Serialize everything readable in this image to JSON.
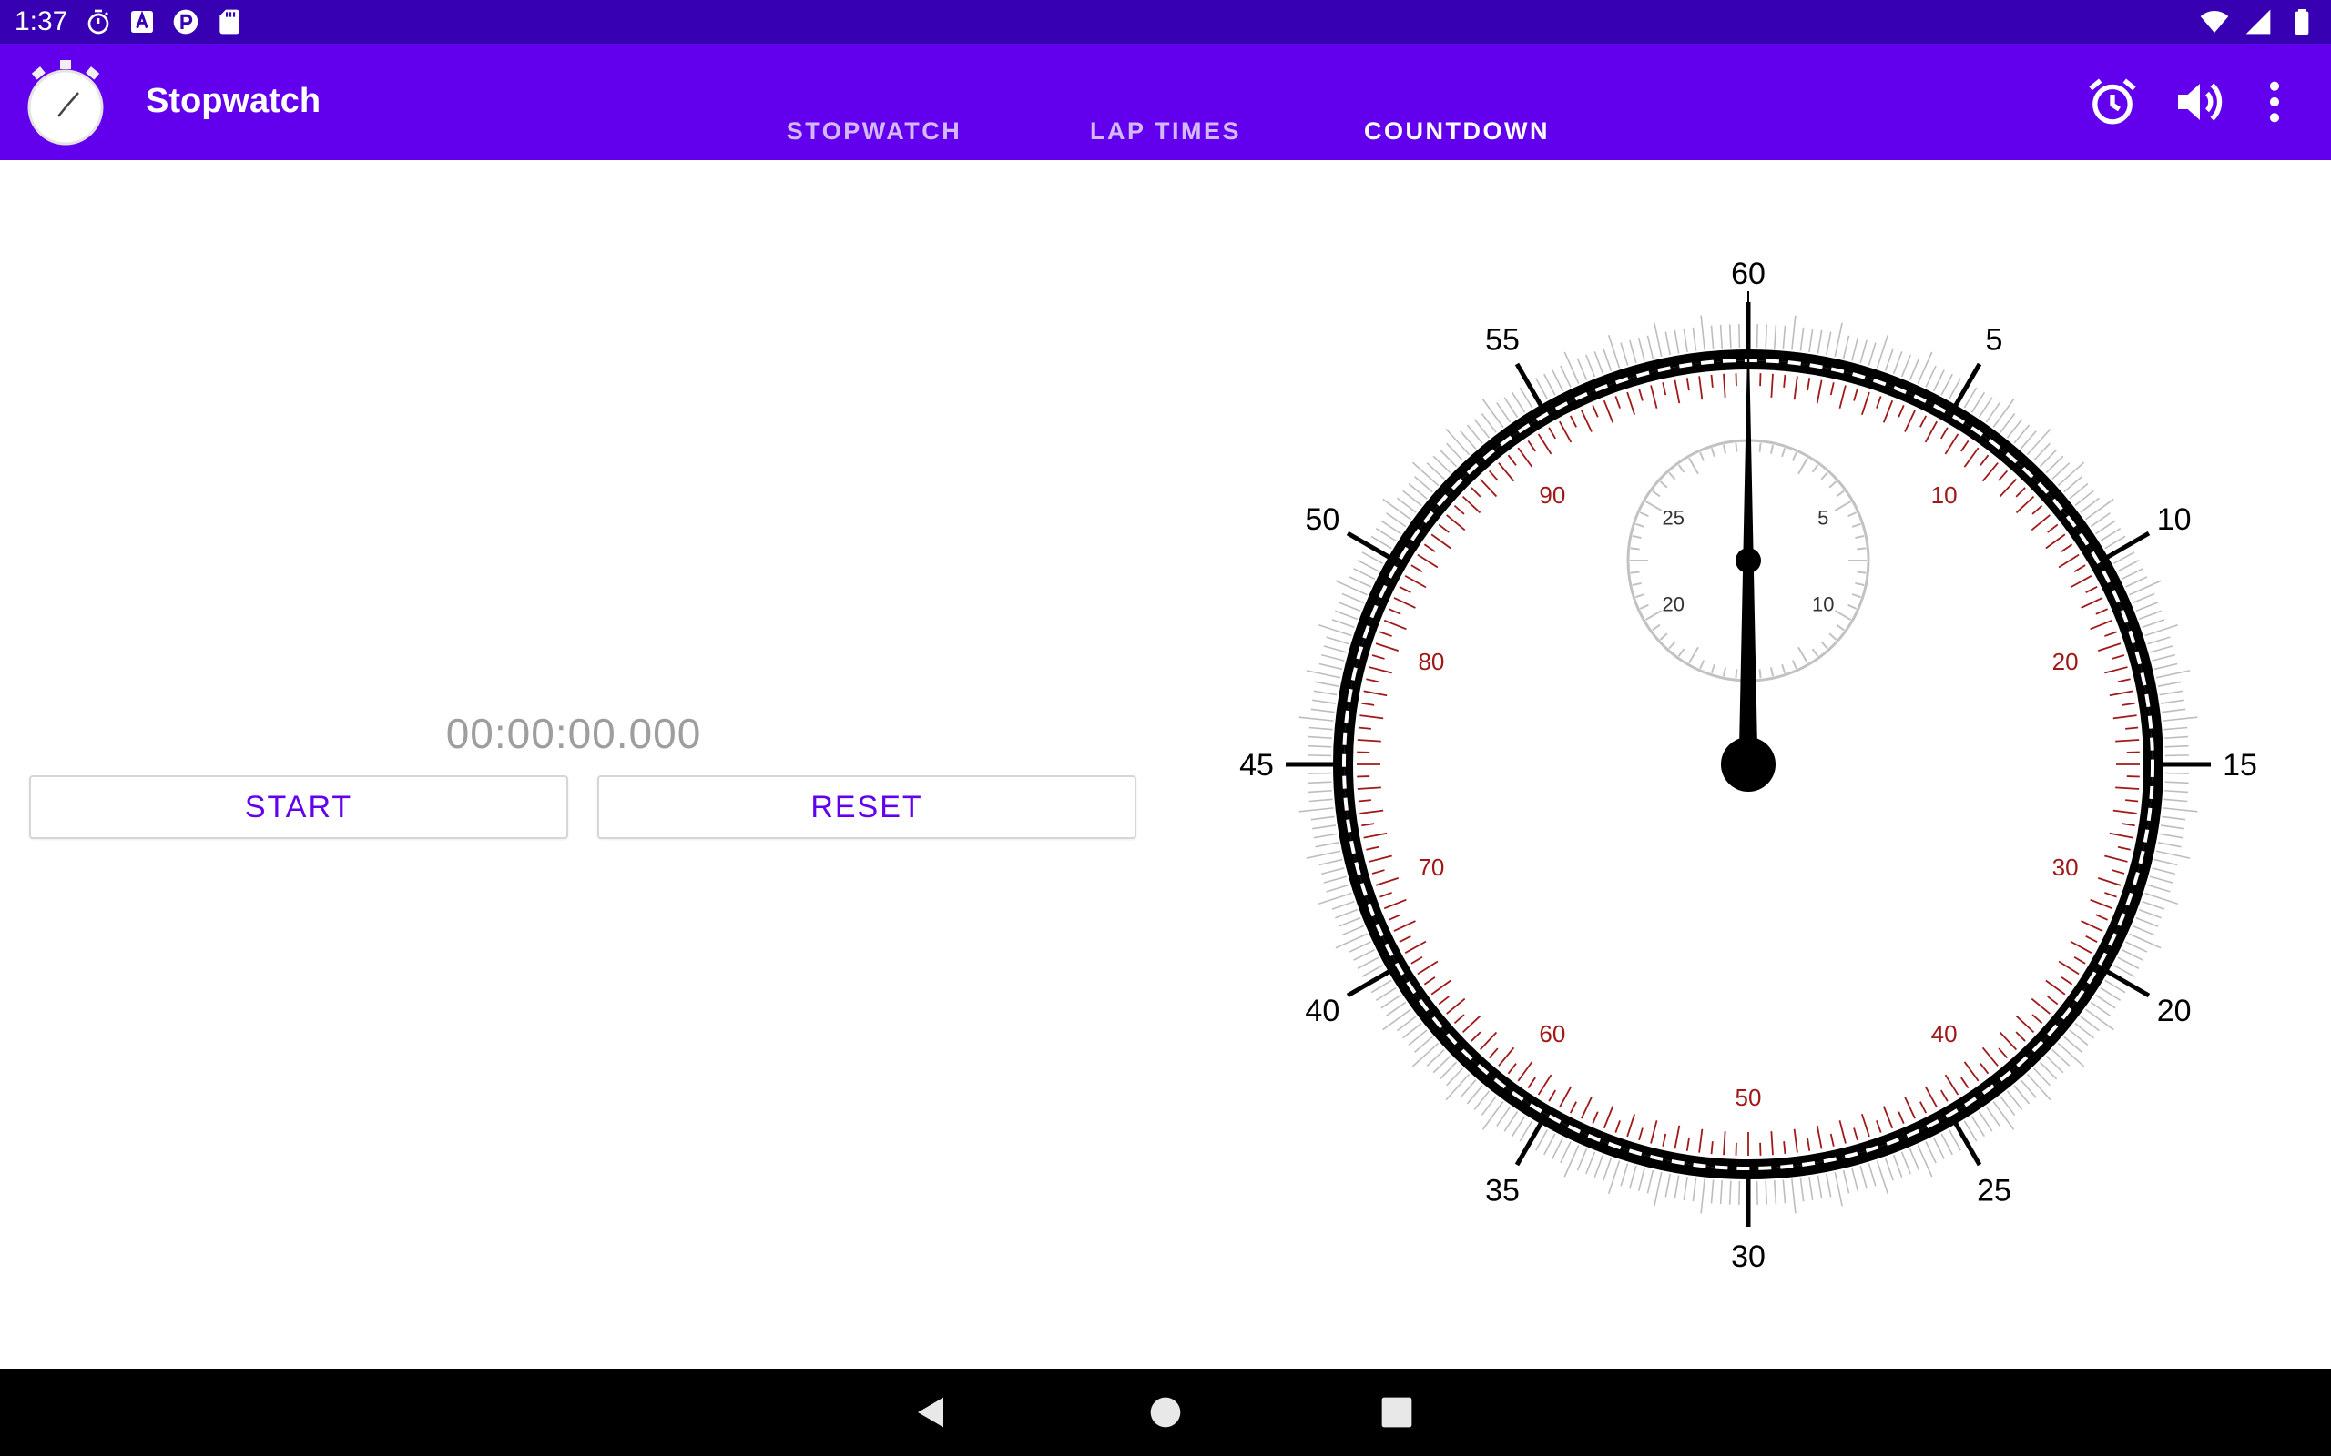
{
  "status_bar": {
    "time": "1:37",
    "left_icons": [
      "stopwatch-icon",
      "text-a-icon",
      "app-p-icon",
      "sd-card-icon"
    ],
    "right_icons": [
      "wifi-icon",
      "cell-signal-icon",
      "battery-icon"
    ]
  },
  "app_bar": {
    "title": "Stopwatch",
    "tabs": [
      {
        "label": "STOPWATCH",
        "active": false
      },
      {
        "label": "LAP TIMES",
        "active": false
      },
      {
        "label": "COUNTDOWN",
        "active": true
      }
    ],
    "actions": [
      "alarm-icon",
      "volume-icon",
      "more-vert-icon"
    ]
  },
  "stopwatch": {
    "display": "00:00:00.000",
    "start_label": "START",
    "reset_label": "RESET"
  },
  "dial": {
    "outer_labels": [
      "60",
      "5",
      "10",
      "15",
      "20",
      "25",
      "30",
      "35",
      "40",
      "45",
      "50",
      "55"
    ],
    "red_labels": [
      "10",
      "20",
      "30",
      "40",
      "50",
      "60",
      "70",
      "80",
      "90"
    ],
    "sub_labels": [
      "5",
      "10",
      "20",
      "25"
    ],
    "hand_seconds": 0,
    "colors": {
      "outer": "#000000",
      "red": "#a01818",
      "minor": "#bdbdbd",
      "sub": "#c2c2c2"
    }
  },
  "colors": {
    "status_bar": "#3700b3",
    "app_bar": "#6200ee",
    "accent": "#6200ee",
    "timer_text": "#9e9e9e"
  },
  "nav_bar": {
    "buttons": [
      "back-icon",
      "home-icon",
      "recents-icon"
    ]
  }
}
